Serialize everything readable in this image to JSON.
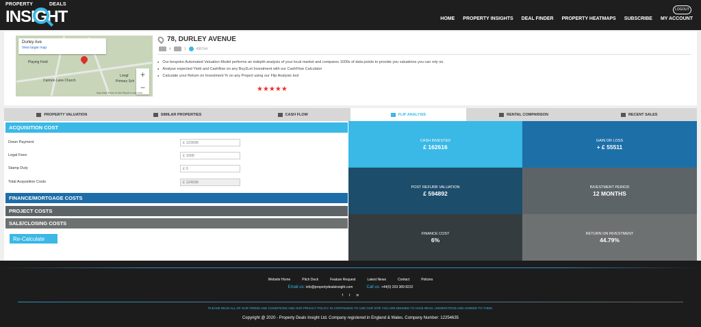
{
  "brand": {
    "line1": "PROPERTY",
    "line2": "INSIGHT",
    "line3": "DEALS",
    "accent": "#3ab8e6"
  },
  "header": {
    "logout": "LOGOUT",
    "nav": [
      "HOME",
      "PROPERTY INSIGHTS",
      "DEAL FINDER",
      "PROPERTY HEATMAPS",
      "SUBSCRIBE",
      "MY ACCOUNT"
    ]
  },
  "property": {
    "address": "78, DURLEY AVENUE",
    "beds": "4",
    "baths": "1",
    "views": "495744",
    "map": {
      "street": "Durley Ave",
      "link": "View larger map",
      "labels": [
        "Playing Field",
        "Cannon Lane Church",
        "Longf",
        "Primary Sch"
      ],
      "zoom_in": "+",
      "zoom_out": "−",
      "attribution": "Map Data   Terms of Use   Report a map error"
    },
    "bullets": [
      "Our bespoke Automated Valuation Model performs an indepth analysis of your local market and compares 1000s of data points to provide you valuations you can rely on.",
      "Analyse expected Yield and Cashflow on any Buy2Let Investment with our CashFlow Calculator",
      "Calculate your Return on Investment % on any Project using our Flip Analysis tool"
    ],
    "rating": "★★★★★"
  },
  "tabs": [
    {
      "label": "PROPERTY VALUATION",
      "icon": "home-icon"
    },
    {
      "label": "SIMILAR PROPERTIES",
      "icon": "building-icon"
    },
    {
      "label": "CASH FLOW",
      "icon": "money-icon"
    },
    {
      "label": "FLIP ANALYSIS",
      "icon": "cash-icon"
    },
    {
      "label": "RENTAL COMPARISON",
      "icon": "factory-icon"
    },
    {
      "label": "RECENT SALES",
      "icon": "money-icon"
    }
  ],
  "acquisition": {
    "title": "ACQUISITION COST",
    "rows": [
      {
        "label": "Down Payment",
        "value": "£ 123936"
      },
      {
        "label": "Legal Fees",
        "value": "£ 1000"
      },
      {
        "label": "Stamp Duty",
        "value": "£ 0"
      },
      {
        "label": "Total Acquisition Costs",
        "value": "£ 124936"
      }
    ]
  },
  "sections": [
    "FINANCE/MORTGAGE COSTS",
    "PROJECT COSTS",
    "SALE/CLOSING COSTS"
  ],
  "recalc": "Re-Calculate",
  "metrics": [
    {
      "key": "CASH INVESTED",
      "value": "£ 162616",
      "color": "#3ab8e6"
    },
    {
      "key": "GAIN OR LOSS",
      "value": "+ £ 55511",
      "color": "#1d6fa8"
    },
    {
      "key": "POST REFURB VALUATION",
      "value": "£ 594892",
      "color": "#1c4d6b"
    },
    {
      "key": "INVESTMENT PERIOD",
      "value": "12 MONTHS",
      "color": "#5d6468"
    },
    {
      "key": "FINANCE COST",
      "value": "6%",
      "color": "#343c40"
    },
    {
      "key": "RETURN ON INVESTMENT",
      "value": "44.79%",
      "color": "#6e7171"
    }
  ],
  "footer": {
    "links": [
      "Website Home",
      "Pitch Deck",
      "Feature Request",
      "Latest News",
      "Contact",
      "Policies"
    ],
    "email_label": "Email us:",
    "email": "info@propertydealsinsight.com",
    "call_label": "Call us:",
    "phone": "+44(0) 203 389 8222",
    "social": [
      "f",
      "t",
      "in"
    ],
    "notice": "PLEASE READ ALL OF OUR TERMS AND CONDITIONS AND OUR PRIVACY POLICY. IN CONTINUING TO USE OUR SITE YOU ARE DEEMED TO HAVE READ, UNDERSTOOD AND AGREED TO THEM.",
    "copyright": "Copyright @ 2020 - Property Deals Insight Ltd. Company registered in England & Wales. Company Number: 12254635"
  }
}
